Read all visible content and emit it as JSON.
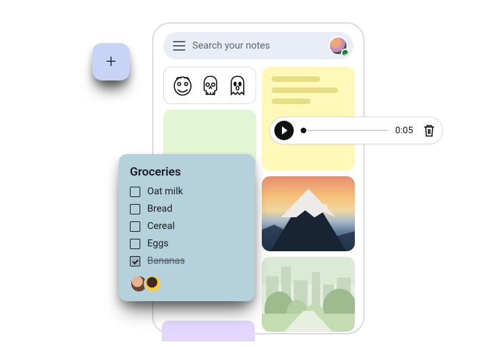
{
  "search": {
    "placeholder": "Search your notes"
  },
  "add_button": {
    "glyph": "+"
  },
  "audio": {
    "time": "0:05"
  },
  "groceries": {
    "title": "Groceries",
    "items": [
      {
        "label": "Oat milk",
        "checked": false
      },
      {
        "label": "Bread",
        "checked": false
      },
      {
        "label": "Cereal",
        "checked": false
      },
      {
        "label": "Eggs",
        "checked": false
      },
      {
        "label": "Bananas",
        "checked": true
      }
    ]
  }
}
